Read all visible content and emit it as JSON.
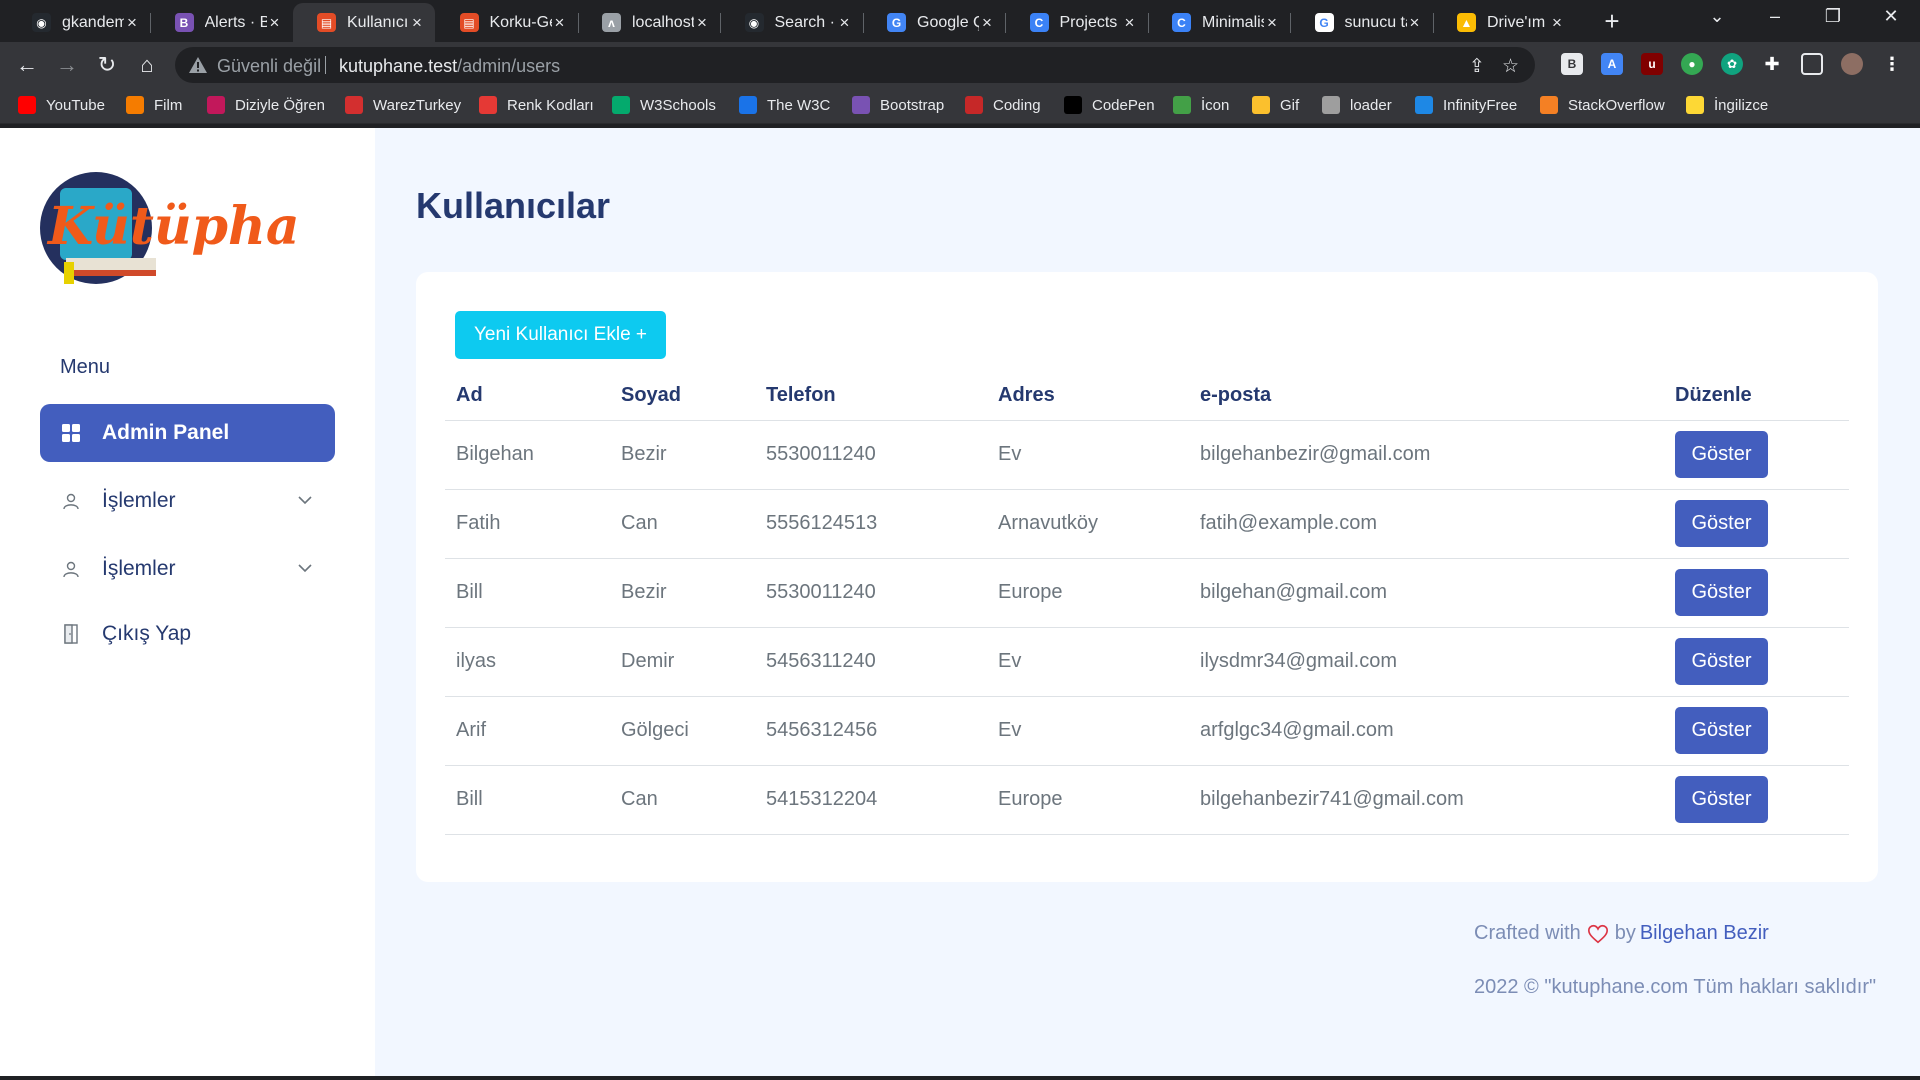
{
  "browser": {
    "tabs": [
      {
        "title": "gkandem",
        "icon": "github-icon",
        "color": "#24292f"
      },
      {
        "title": "Alerts · Bo",
        "icon": "bootstrap-icon",
        "color": "#7952b3"
      },
      {
        "title": "Kullanıcıla",
        "icon": "html-file-icon",
        "color": "#e34c26"
      },
      {
        "title": "Korku-Ge",
        "icon": "html-file-icon",
        "color": "#e34c26"
      },
      {
        "title": "localhost",
        "icon": "laravel-icon",
        "color": "#9aa0a6"
      },
      {
        "title": "Search · f",
        "icon": "github-icon",
        "color": "#24292f"
      },
      {
        "title": "Google Ç",
        "icon": "google-translate-icon",
        "color": "#4285f4"
      },
      {
        "title": "Projects -",
        "icon": "canva-icon",
        "color": "#3b82f6"
      },
      {
        "title": "Minimalis",
        "icon": "canva-icon",
        "color": "#3b82f6"
      },
      {
        "title": "sunucu ta",
        "icon": "google-icon",
        "color": "#ffffff"
      },
      {
        "title": "Drive'ım",
        "icon": "google-drive-icon",
        "color": "#fbbc04"
      }
    ],
    "address": {
      "insecure_label": "Güvenli değil",
      "host": "kutuphane.test",
      "path": "/admin/users"
    },
    "bookmarks": [
      {
        "label": "YouTube",
        "color": "#ff0000"
      },
      {
        "label": "Film",
        "color": "#f57c00"
      },
      {
        "label": "Diziyle Öğren",
        "color": "#c2185b"
      },
      {
        "label": "WarezTurkey",
        "color": "#d32f2f"
      },
      {
        "label": "Renk Kodları",
        "color": "#e53935"
      },
      {
        "label": "W3Schools",
        "color": "#04aa6d"
      },
      {
        "label": "The W3C",
        "color": "#1a73e8"
      },
      {
        "label": "Bootstrap",
        "color": "#7952b3"
      },
      {
        "label": "Coding",
        "color": "#c62828"
      },
      {
        "label": "CodePen",
        "color": "#000000"
      },
      {
        "label": "İcon",
        "color": "#43a047"
      },
      {
        "label": "Gif",
        "color": "#fbc02d"
      },
      {
        "label": "loader",
        "color": "#9e9e9e"
      },
      {
        "label": "InfinityFree",
        "color": "#1e88e5"
      },
      {
        "label": "StackOverflow",
        "color": "#f48024"
      },
      {
        "label": "İngilizce",
        "color": "#fdd835"
      }
    ]
  },
  "sidebar": {
    "logo_text": "Kütüphane",
    "menu_title": "Menu",
    "items": [
      {
        "label": "Admin Panel",
        "icon": "grid-icon",
        "active": true
      },
      {
        "label": "İşlemler",
        "icon": "user-icon",
        "active": false
      },
      {
        "label": "İşlemler",
        "icon": "user-icon",
        "active": false
      },
      {
        "label": "Çıkış Yap",
        "icon": "door-icon",
        "active": false
      }
    ]
  },
  "main": {
    "title": "Kullanıcılar",
    "add_button": "Yeni Kullanıcı Ekle +",
    "table": {
      "headers": [
        "Ad",
        "Soyad",
        "Telefon",
        "Adres",
        "e-posta",
        "Düzenle"
      ],
      "rows": [
        [
          "Bilgehan",
          "Bezir",
          "5530011240",
          "Ev",
          "bilgehanbezir@gmail.com",
          "Göster"
        ],
        [
          "Fatih",
          "Can",
          "5556124513",
          "Arnavutköy",
          "fatih@example.com",
          "Göster"
        ],
        [
          "Bill",
          "Bezir",
          "5530011240",
          "Europe",
          "bilgehan@gmail.com",
          "Göster"
        ],
        [
          "ilyas",
          "Demir",
          "5456311240",
          "Ev",
          "ilysdmr34@gmail.com",
          "Göster"
        ],
        [
          "Arif",
          "Gölgeci",
          "5456312456",
          "Ev",
          "arfglgc34@gmail.com",
          "Göster"
        ],
        [
          "Bill",
          "Can",
          "5415312204",
          "Europe",
          "bilgehanbezir741@gmail.com",
          "Göster"
        ]
      ]
    }
  },
  "footer": {
    "crafted_prefix": "Crafted with",
    "crafted_by": "by",
    "author": "Bilgehan Bezir",
    "copyright": "2022 © \"kutuphane.com Tüm hakları saklıdır\""
  },
  "colors": {
    "primary": "#435ebe",
    "info": "#0dcaf0",
    "heading": "#25396f",
    "background": "#f2f7ff"
  }
}
